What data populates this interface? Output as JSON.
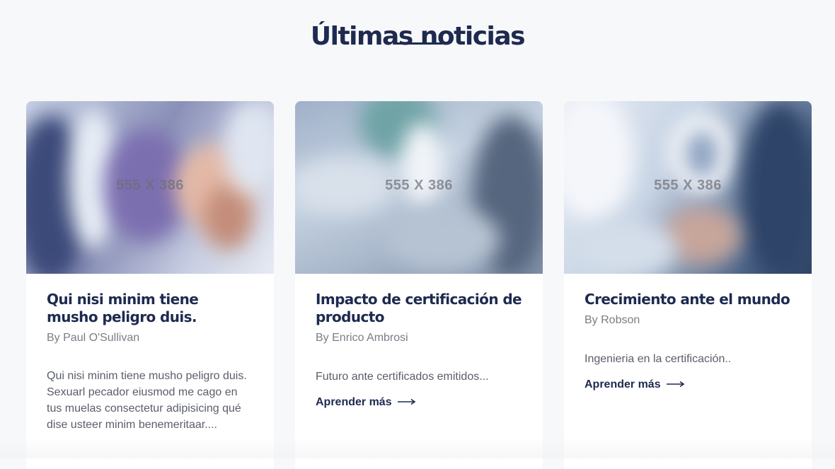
{
  "section": {
    "title": "Últimas noticias"
  },
  "cards": [
    {
      "image_placeholder": "555 X 386",
      "title": "Qui nisi minim tiene musho peligro duis.",
      "author": "By Paul O'Sullivan",
      "excerpt": "Qui nisi minim tiene musho peligro duis. Sexuarl pecador eiusmod me cago en tus muelas consectetur adipisicing qué dise usteer minim benemeritaar....",
      "link_label": ""
    },
    {
      "image_placeholder": "555 X 386",
      "title": "Impacto de certificación de producto",
      "author": "By Enrico Ambrosi",
      "excerpt": "Futuro ante certificados emitidos...",
      "link_label": "Aprender más"
    },
    {
      "image_placeholder": "555 X 386",
      "title": "Crecimiento ante el mundo",
      "author": "By Robson",
      "excerpt": "Ingenieria en la certificación..",
      "link_label": "Aprender más"
    }
  ],
  "colors": {
    "heading": "#1e2a4f",
    "background": "#f7f8fa",
    "card": "#ffffff",
    "muted_text": "#7a7d85"
  },
  "icons": {
    "link_arrow": "long-arrow-right-icon"
  }
}
